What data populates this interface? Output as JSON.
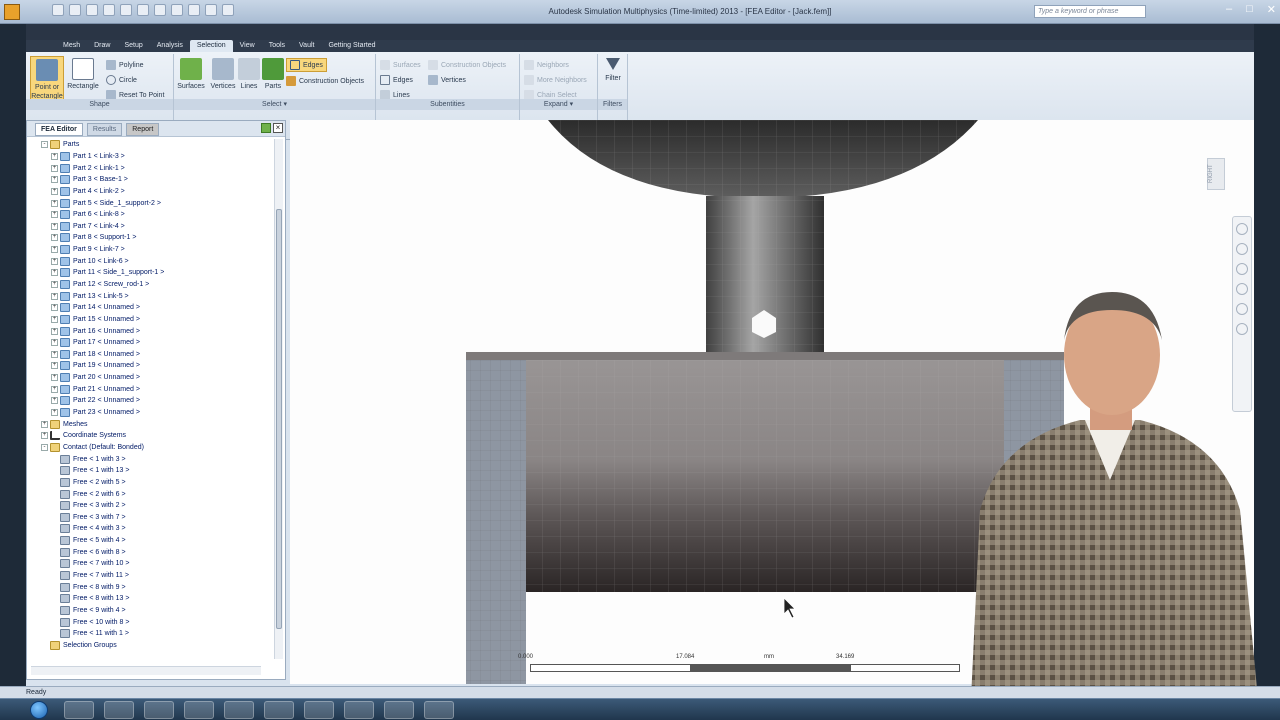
{
  "window": {
    "title": "Autodesk Simulation Multiphysics (Time-limited) 2013 - [FEA Editor - [Jack.fem]]",
    "search_placeholder": "Type a keyword or phrase"
  },
  "menu_tabs": [
    "Mesh",
    "Draw",
    "Setup",
    "Analysis",
    "Selection",
    "View",
    "Tools",
    "Vault",
    "Getting Started"
  ],
  "active_menu_tab": "Selection",
  "ribbon": {
    "shape": {
      "label": "Shape",
      "point_or_rectangle": "Point or Rectangle",
      "rectangle": "Rectangle",
      "polyline": "Polyline",
      "circle": "Circle",
      "reset_to_point": "Reset To Point"
    },
    "select": {
      "label": "Select",
      "surfaces": "Surfaces",
      "vertices": "Vertices",
      "lines": "Lines",
      "parts": "Parts",
      "edges": "Edges",
      "construction_objects": "Construction Objects"
    },
    "subentities": {
      "label": "Subentities",
      "surfaces": "Surfaces",
      "construction_objects": "Construction Objects",
      "edges": "Edges",
      "vertices": "Vertices",
      "lines": "Lines"
    },
    "expand": {
      "label": "Expand",
      "neighbors": "Neighbors",
      "more_neighbors": "More Neighbors",
      "chain_select": "Chain Select"
    },
    "filters": {
      "label": "Filters",
      "filter": "Filter"
    }
  },
  "left_panel": {
    "tabs": {
      "fea_editor": "FEA Editor",
      "results": "Results",
      "report": "Report"
    },
    "tree": [
      {
        "text": "Parts",
        "icon": "folder",
        "indent": 1,
        "exp": "-"
      },
      {
        "text": "Part 1 < Link-3 >",
        "icon": "part",
        "indent": 2,
        "exp": "+"
      },
      {
        "text": "Part 2 < Link-1 >",
        "icon": "part",
        "indent": 2,
        "exp": "+"
      },
      {
        "text": "Part 3 < Base-1 >",
        "icon": "part",
        "indent": 2,
        "exp": "+"
      },
      {
        "text": "Part 4 < Link-2 >",
        "icon": "part",
        "indent": 2,
        "exp": "+"
      },
      {
        "text": "Part 5 < Side_1_support-2 >",
        "icon": "part",
        "indent": 2,
        "exp": "+"
      },
      {
        "text": "Part 6 < Link-8 >",
        "icon": "part",
        "indent": 2,
        "exp": "+"
      },
      {
        "text": "Part 7 < Link-4 >",
        "icon": "part",
        "indent": 2,
        "exp": "+"
      },
      {
        "text": "Part 8 < Support-1 >",
        "icon": "part",
        "indent": 2,
        "exp": "+"
      },
      {
        "text": "Part 9 < Link-7 >",
        "icon": "part",
        "indent": 2,
        "exp": "+"
      },
      {
        "text": "Part 10 < Link-6 >",
        "icon": "part",
        "indent": 2,
        "exp": "+"
      },
      {
        "text": "Part 11 < Side_1_support-1 >",
        "icon": "part",
        "indent": 2,
        "exp": "+"
      },
      {
        "text": "Part 12 < Screw_rod-1 >",
        "icon": "part",
        "indent": 2,
        "exp": "+"
      },
      {
        "text": "Part 13 < Link-5 >",
        "icon": "part",
        "indent": 2,
        "exp": "+"
      },
      {
        "text": "Part 14 < Unnamed >",
        "icon": "part",
        "indent": 2,
        "exp": "+"
      },
      {
        "text": "Part 15 < Unnamed >",
        "icon": "part",
        "indent": 2,
        "exp": "+"
      },
      {
        "text": "Part 16 < Unnamed >",
        "icon": "part",
        "indent": 2,
        "exp": "+"
      },
      {
        "text": "Part 17 < Unnamed >",
        "icon": "part",
        "indent": 2,
        "exp": "+"
      },
      {
        "text": "Part 18 < Unnamed >",
        "icon": "part",
        "indent": 2,
        "exp": "+"
      },
      {
        "text": "Part 19 < Unnamed >",
        "icon": "part",
        "indent": 2,
        "exp": "+"
      },
      {
        "text": "Part 20 < Unnamed >",
        "icon": "part",
        "indent": 2,
        "exp": "+"
      },
      {
        "text": "Part 21 < Unnamed >",
        "icon": "part",
        "indent": 2,
        "exp": "+"
      },
      {
        "text": "Part 22 < Unnamed >",
        "icon": "part",
        "indent": 2,
        "exp": "+"
      },
      {
        "text": "Part 23 < Unnamed >",
        "icon": "part",
        "indent": 2,
        "exp": "+"
      },
      {
        "text": "Meshes",
        "icon": "folder",
        "indent": 1,
        "exp": "+"
      },
      {
        "text": "Coordinate Systems",
        "icon": "coord",
        "indent": 1,
        "exp": "+"
      },
      {
        "text": "Contact (Default: Bonded)",
        "icon": "folder",
        "indent": 1,
        "exp": "-"
      },
      {
        "text": "Free < 1 with 3 >",
        "icon": "contact",
        "indent": 2,
        "exp": ""
      },
      {
        "text": "Free < 1 with 13 >",
        "icon": "contact",
        "indent": 2,
        "exp": ""
      },
      {
        "text": "Free < 2 with 5 >",
        "icon": "contact",
        "indent": 2,
        "exp": ""
      },
      {
        "text": "Free < 2 with 6 >",
        "icon": "contact",
        "indent": 2,
        "exp": ""
      },
      {
        "text": "Free < 3 with 2 >",
        "icon": "contact",
        "indent": 2,
        "exp": ""
      },
      {
        "text": "Free < 3 with 7 >",
        "icon": "contact",
        "indent": 2,
        "exp": ""
      },
      {
        "text": "Free < 4 with 3 >",
        "icon": "contact",
        "indent": 2,
        "exp": ""
      },
      {
        "text": "Free < 5 with 4 >",
        "icon": "contact",
        "indent": 2,
        "exp": ""
      },
      {
        "text": "Free < 6 with 8 >",
        "icon": "contact",
        "indent": 2,
        "exp": ""
      },
      {
        "text": "Free < 7 with 10 >",
        "icon": "contact",
        "indent": 2,
        "exp": ""
      },
      {
        "text": "Free < 7 with 11 >",
        "icon": "contact",
        "indent": 2,
        "exp": ""
      },
      {
        "text": "Free < 8 with 9 >",
        "icon": "contact",
        "indent": 2,
        "exp": ""
      },
      {
        "text": "Free < 8 with 13 >",
        "icon": "contact",
        "indent": 2,
        "exp": ""
      },
      {
        "text": "Free < 9 with 4 >",
        "icon": "contact",
        "indent": 2,
        "exp": ""
      },
      {
        "text": "Free < 10 with 8 >",
        "icon": "contact",
        "indent": 2,
        "exp": ""
      },
      {
        "text": "Free < 11 with 1 >",
        "icon": "contact",
        "indent": 2,
        "exp": ""
      },
      {
        "text": "Selection Groups",
        "icon": "folder",
        "indent": 1,
        "exp": ""
      }
    ]
  },
  "viewport": {
    "view_cube_label": "RIGHT",
    "scale": {
      "left": "0.000",
      "mid": "17.084",
      "unit": "mm",
      "right": "34.169"
    }
  },
  "status": {
    "text": "Ready"
  },
  "colors": {
    "accent": "#f8d77d",
    "ribbon_bg": "#dfe8f2",
    "taskbar": "#2a4460"
  }
}
